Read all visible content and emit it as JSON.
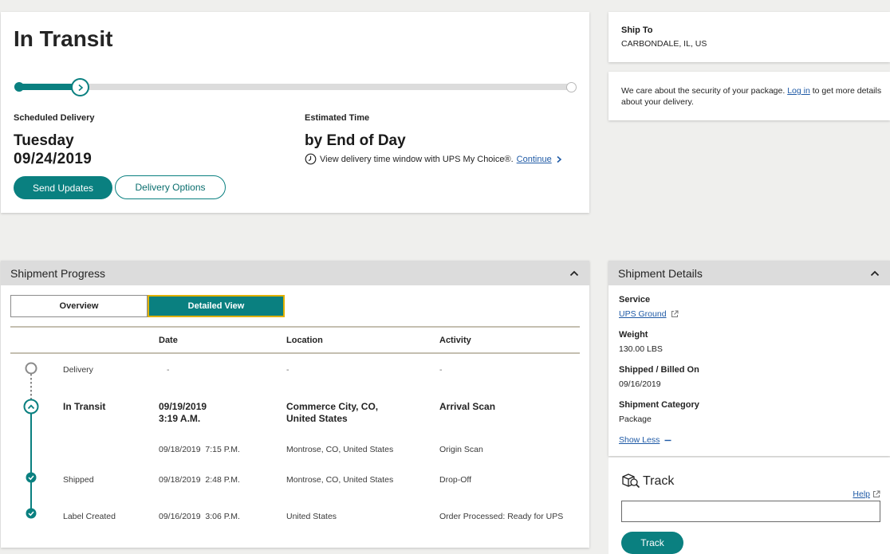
{
  "status": {
    "title": "In Transit",
    "scheduled_label": "Scheduled Delivery",
    "scheduled_day": "Tuesday",
    "scheduled_date": "09/24/2019",
    "estimated_label": "Estimated Time",
    "estimated_value": "by End of Day",
    "mychoice_text": "View delivery time window with UPS My Choice®.",
    "mychoice_link": "Continue",
    "send_updates": "Send Updates",
    "delivery_options": "Delivery Options",
    "progress_fraction": 0.12
  },
  "ship_to": {
    "label": "Ship To",
    "value": "CARBONDALE, IL, US"
  },
  "security": {
    "text_before": "We care about the security of your package.",
    "login_link": "Log in",
    "text_after": "to get more details about your delivery."
  },
  "shipment_progress": {
    "title": "Shipment Progress",
    "tabs": {
      "overview": "Overview",
      "detailed": "Detailed View"
    },
    "columns": {
      "date": "Date",
      "location": "Location",
      "activity": "Activity"
    },
    "rows": [
      {
        "status": "Delivery",
        "date": "-",
        "location": "-",
        "activity": "-"
      },
      {
        "status": "In Transit",
        "date_line1": "09/19/2019",
        "date_line2": "3:19 A.M.",
        "location_line1": "Commerce City, CO,",
        "location_line2": "United States",
        "activity": "Arrival Scan"
      },
      {
        "status": "",
        "date": "09/18/2019  7:15 P.M.",
        "location": "Montrose, CO, United States",
        "activity": "Origin Scan"
      },
      {
        "status": "Shipped",
        "date": "09/18/2019  2:48 P.M.",
        "location": "Montrose, CO, United States",
        "activity": "Drop-Off"
      },
      {
        "status": "Label Created",
        "date": "09/16/2019  3:06 P.M.",
        "location": "United States",
        "activity": "Order Processed: Ready for UPS"
      }
    ]
  },
  "shipment_details": {
    "title": "Shipment Details",
    "service_label": "Service",
    "service_value": "UPS Ground",
    "weight_label": "Weight",
    "weight_value": "130.00 LBS",
    "shipped_label": "Shipped / Billed On",
    "shipped_value": "09/16/2019",
    "category_label": "Shipment Category",
    "category_value": "Package",
    "show_less": "Show Less"
  },
  "track": {
    "title": "Track",
    "help": "Help",
    "input_value": "",
    "button": "Track"
  },
  "colors": {
    "accent": "#0a8080",
    "focus": "#e0b000",
    "link": "#1f5aa6"
  }
}
